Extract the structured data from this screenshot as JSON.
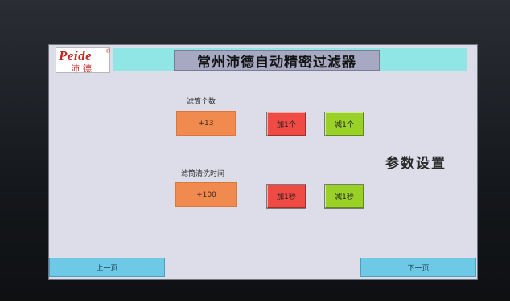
{
  "header": {
    "logo_latin": "Peide",
    "logo_mark": "®",
    "logo_cn": "沛德",
    "title": "常州沛德自动精密过滤器"
  },
  "page_heading": "参数设置",
  "filter_count": {
    "label": "滤筒个数",
    "value": "+13",
    "increase_label": "加1个",
    "decrease_label": "减1个"
  },
  "clean_time": {
    "label": "滤筒清洗时间",
    "value": "+100",
    "increase_label": "加1秒",
    "decrease_label": "减1秒"
  },
  "nav": {
    "prev_label": "上一页",
    "next_label": "下一页"
  },
  "colors": {
    "screen_bg": "#dcdde9",
    "header_band": "#8fe6e4",
    "title_box": "#a7a9c3",
    "value_box": "#f08a4f",
    "btn_red": "#f04a44",
    "btn_green": "#99d127",
    "nav_btn": "#6ec9e6",
    "logo_red": "#c2261f"
  }
}
